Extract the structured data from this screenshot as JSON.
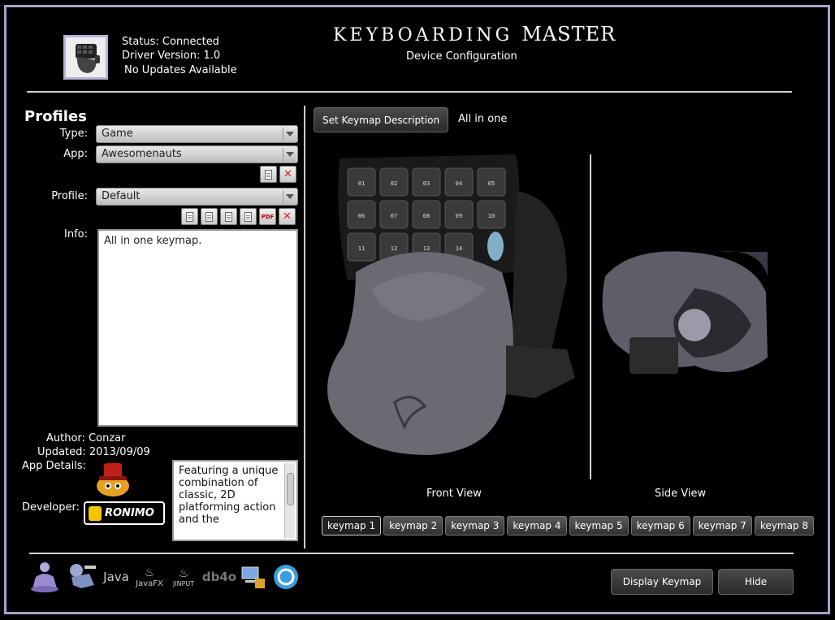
{
  "header": {
    "status": "Status: Connected",
    "driver_version": "Driver Version: 1.0",
    "updates": "No Updates Available",
    "title_prefix": "KEYBOARDING",
    "title_suffix": "MASTER",
    "subtitle": "Device Configuration"
  },
  "profiles": {
    "heading": "Profiles",
    "type_label": "Type:",
    "type_value": "Game",
    "app_label": "App:",
    "app_value": "Awesomenauts",
    "profile_label": "Profile:",
    "profile_value": "Default",
    "info_label": "Info:",
    "info_text": "All in one keymap.",
    "author": "Author: Conzar",
    "updated": "Updated: 2013/09/09",
    "app_details_label": "App Details:",
    "developer_label": "Developer:",
    "developer_name": "RONIMO",
    "description": "Featuring a unique combination of classic, 2D platforming action and the"
  },
  "keymap": {
    "set_description_button": "Set Keymap Description",
    "description": "All in one",
    "front_view_label": "Front View",
    "side_view_label": "Side View",
    "key_labels": [
      "01",
      "02",
      "03",
      "04",
      "05",
      "06",
      "07",
      "08",
      "09",
      "10",
      "11",
      "12",
      "13",
      "14"
    ],
    "tabs": [
      "keymap 1",
      "keymap 2",
      "keymap 3",
      "keymap 4",
      "keymap 5",
      "keymap 6",
      "keymap 7",
      "keymap 8"
    ]
  },
  "footer": {
    "logos": [
      "Java",
      "JavaFX",
      "JINPUT",
      "db4o"
    ],
    "display_keymap_button": "Display Keymap",
    "hide_button": "Hide"
  }
}
